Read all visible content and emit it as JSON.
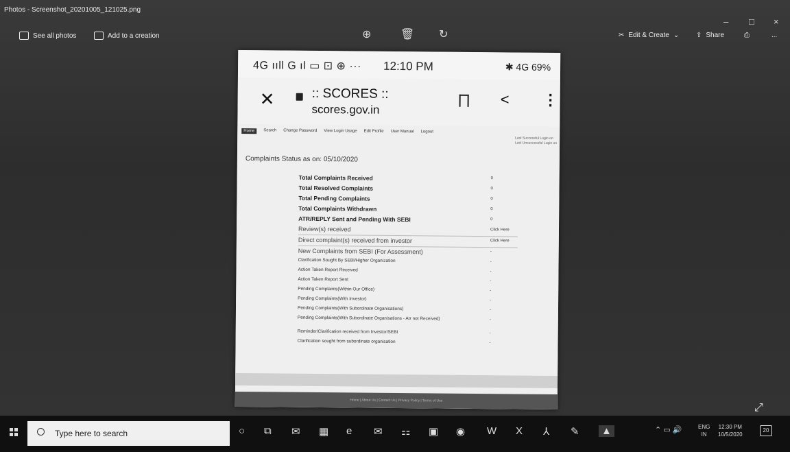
{
  "window": {
    "title": "Photos - Screenshot_20201005_121025.png",
    "min": "–",
    "max": "□",
    "close": "×"
  },
  "toolbar": {
    "see_all": "See all photos",
    "add_creation": "Add to a creation",
    "edit_create": "Edit & Create",
    "share": "Share",
    "more": "..."
  },
  "phone": {
    "status_left": "4G ııll G ıl   ▭ ⊡ ⊕ ···",
    "time": "12:10 PM",
    "status_right": "✱ 4G 69%",
    "site_title": ":: SCORES ::",
    "host": "scores.gov.in"
  },
  "scores": {
    "nav": [
      "Home",
      "Search",
      "Change Password",
      "View Login Usage",
      "Edit Profile",
      "User Manual",
      "Logout"
    ],
    "last_success": "Last Successful Login on",
    "last_unsuccess": "Last Unsuccessful Login on",
    "status_title": "Complaints Status as on: 05/10/2020",
    "rows": [
      {
        "label": "Total Complaints Received",
        "value": "0"
      },
      {
        "label": "Total Resolved Complaints",
        "value": "0"
      },
      {
        "label": "Total Pending Complaints",
        "value": "0"
      },
      {
        "label": "Total Complaints Withdrawn",
        "value": "0"
      },
      {
        "label": "ATR/REPLY Sent and Pending With SEBI",
        "value": "0"
      },
      {
        "label": "Review(s) received",
        "value": "Click Here"
      },
      {
        "label": "Direct complaint(s) received from investor",
        "value": "Click Here"
      },
      {
        "label": "New Complaints from SEBI (For Assessment)",
        "value": "-"
      },
      {
        "label": "Clarification Sought By SEBI/Higher Organization",
        "value": "-"
      },
      {
        "label": "Action Taken Report Received",
        "value": "-"
      },
      {
        "label": "Action Taken Report Sent",
        "value": "-"
      },
      {
        "label": "Pending Complaints(Within Our Office)",
        "value": "-"
      },
      {
        "label": "Pending Complaints(With Investor)",
        "value": "-"
      },
      {
        "label": "Pending Complaints(With Subordinate Organisations)",
        "value": "-"
      },
      {
        "label": "Pending Complaints(With Subordinate Organisations - Atr not Received)",
        "value": "-"
      },
      {
        "label": "Reminder/Clarification received from Investor/SEBI",
        "value": "-"
      },
      {
        "label": "Clarification sought from subordinate organisation",
        "value": "-"
      }
    ],
    "footer": "Home | About Us | Contact Us | Privacy Policy | Terms of Use"
  },
  "taskbar": {
    "search_placeholder": "Type here to search",
    "lang": "ENG",
    "region": "IN",
    "time": "12:30 PM",
    "date": "10/5/2020",
    "notifications": "20"
  }
}
